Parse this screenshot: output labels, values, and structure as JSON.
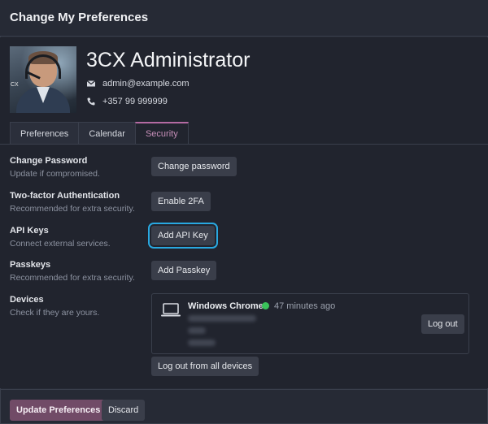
{
  "header": {
    "title": "Change My Preferences"
  },
  "user": {
    "name": "3CX Administrator",
    "email": "admin@example.com",
    "phone": "+357 99 999999",
    "avatar_tag": "CX"
  },
  "tabs": [
    {
      "label": "Preferences",
      "active": false
    },
    {
      "label": "Calendar",
      "active": false
    },
    {
      "label": "Security",
      "active": true
    }
  ],
  "security": {
    "change_password": {
      "title": "Change Password",
      "desc": "Update if compromised.",
      "button": "Change password"
    },
    "two_factor": {
      "title": "Two-factor Authentication",
      "desc": "Recommended for extra security.",
      "button": "Enable 2FA"
    },
    "api_keys": {
      "title": "API Keys",
      "desc": "Connect external services.",
      "button": "Add API Key"
    },
    "passkeys": {
      "title": "Passkeys",
      "desc": "Recommended for extra security.",
      "button": "Add Passkey"
    },
    "devices": {
      "title": "Devices",
      "desc": "Check if they are yours.",
      "items": [
        {
          "name": "Windows Chrome",
          "status": "online",
          "last_seen": "47 minutes ago",
          "icon": "laptop-icon",
          "logout_label": "Log out"
        }
      ],
      "logout_all_label": "Log out from all devices"
    }
  },
  "footer": {
    "save_label": "Update Preferences",
    "discard_label": "Discard"
  },
  "colors": {
    "accent": "#714b67",
    "tab_active": "#c78fb9",
    "focus_ring": "#29a8e0",
    "online": "#3ac25a",
    "background": "#21242e"
  }
}
